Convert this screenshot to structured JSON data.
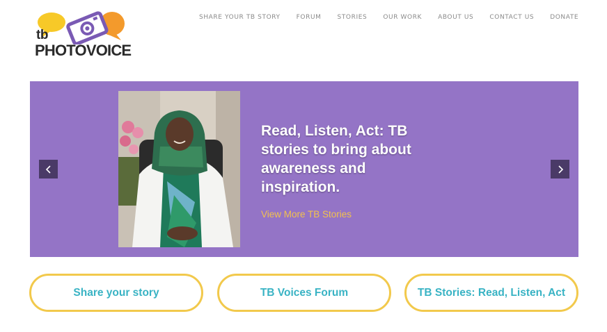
{
  "logo": {
    "small": "tb",
    "name": "PHOTOVOICE"
  },
  "nav": {
    "items": [
      {
        "label": "SHARE YOUR TB STORY"
      },
      {
        "label": "FORUM"
      },
      {
        "label": "STORIES"
      },
      {
        "label": "OUR WORK"
      },
      {
        "label": "ABOUT US"
      },
      {
        "label": "CONTACT US"
      },
      {
        "label": "DONATE"
      }
    ]
  },
  "hero": {
    "title": "Read, Listen, Act: TB stories to bring about awareness and inspiration.",
    "link": "View More TB Stories",
    "background_color": "#9474c6",
    "link_color": "#f2c14e",
    "arrow_left_icon": "chevron-left-icon",
    "arrow_right_icon": "chevron-right-icon"
  },
  "cta": {
    "share": "Share your story",
    "forum": "TB Voices Forum",
    "stories": "TB Stories: Read, Listen, Act",
    "border_color": "#f2c94c",
    "text_color": "#39b3c4"
  }
}
